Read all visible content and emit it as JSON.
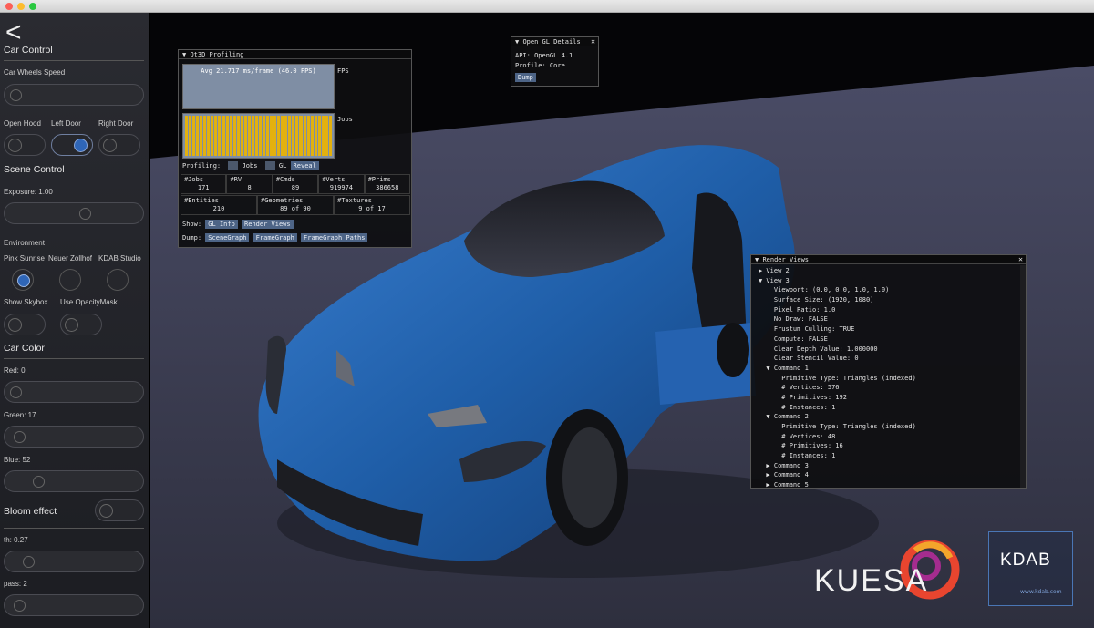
{
  "sidebar": {
    "back_symbol": "<",
    "car_control": "Car Control",
    "wheels_speed": "Car Wheels Speed",
    "open_hood": "Open Hood",
    "left_door": "Left Door",
    "right_door": "Right Door",
    "scene_control": "Scene Control",
    "exposure": "Exposure: 1.00",
    "environment": "Environment",
    "env_pink": "Pink Sunrise",
    "env_neuer": "Neuer Zollhof",
    "env_kdab": "KDAB Studio",
    "show_skybox": "Show Skybox",
    "opacity_mask": "Use OpacityMask",
    "car_color": "Car Color",
    "red": "Red: 0",
    "green": "Green: 17",
    "blue": "Blue: 52",
    "bloom": "Bloom effect",
    "th": "th: 0.27",
    "pass": "pass: 2"
  },
  "profiling": {
    "title": "Qt3D Profiling",
    "fps_label": "Avg 21.717 ms/frame (46.0 FPS)",
    "fps_axis": "FPS",
    "jobs_axis": "Jobs",
    "profiling_label": "Profiling:",
    "jobs_cb": "Jobs",
    "gl_cb": "GL",
    "reveal": "Reveal",
    "stats_row1": [
      {
        "k": "#Jobs",
        "v": "171"
      },
      {
        "k": "#RV",
        "v": "8"
      },
      {
        "k": "#Cmds",
        "v": "89"
      },
      {
        "k": "#Verts",
        "v": "919974"
      },
      {
        "k": "#Prims",
        "v": "386658"
      }
    ],
    "stats_row2": [
      {
        "k": "#Entities",
        "v": "210"
      },
      {
        "k": "#Geometries",
        "v": "89 of 90"
      },
      {
        "k": "#Textures",
        "v": "9 of 17"
      }
    ],
    "show_label": "Show:",
    "gl_info": "GL Info",
    "render_views": "Render Views",
    "dump_label": "Dump:",
    "scene_graph": "SceneGraph",
    "frame_graph": "FrameGraph",
    "frame_graph_paths": "FrameGraph Paths"
  },
  "gl": {
    "title": "Open GL Details",
    "close": "✕",
    "api": "API: OpenGL 4.1",
    "profile": "Profile: Core",
    "dump": "Dump"
  },
  "render_views": {
    "title": "Render Views",
    "close": "✕",
    "lines": [
      "▶ View 2",
      "▼ View 3",
      "    Viewport: (0.0, 0.0, 1.0, 1.0)",
      "    Surface Size: (1920, 1080)",
      "    Pixel Ratio: 1.0",
      "    No Draw: FALSE",
      "    Frustum Culling: TRUE",
      "    Compute: FALSE",
      "    Clear Depth Value: 1.000000",
      "    Clear Stencil Value: 0",
      "  ▼ Command 1",
      "      Primitive Type: Triangles (indexed)",
      "      # Vertices: 576",
      "      # Primitives: 192",
      "      # Instances: 1",
      "  ▼ Command 2",
      "      Primitive Type: Triangles (indexed)",
      "      # Vertices: 48",
      "      # Primitives: 16",
      "      # Instances: 1",
      "  ▶ Command 3",
      "  ▶ Command 4",
      "  ▶ Command 5"
    ]
  },
  "logos": {
    "kuesa": "KUESA",
    "kdab": "KDAB",
    "kdab_url": "www.kdab.com"
  },
  "colors": {
    "car_blue": "#1f5ea8",
    "accent": "#2f66b7",
    "jobs_bar": "#e3b10f",
    "button": "#4d6486"
  }
}
